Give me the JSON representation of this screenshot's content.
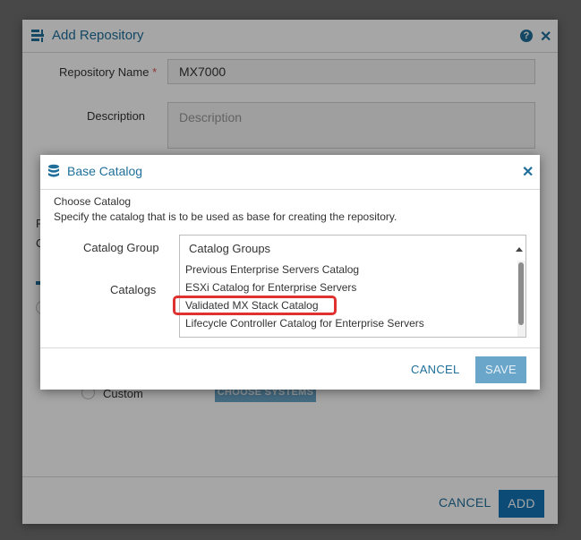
{
  "outer_dialog": {
    "title": "Add Repository",
    "help_icon": "?",
    "close_icon": "✕",
    "repository_name_label": "Repository Name",
    "required_marker": "*",
    "repository_name_value": "MX7000",
    "description_label": "Description",
    "description_placeholder": "Description",
    "partial_label_1": "R",
    "partial_label_2": "C",
    "custom_label": "Custom",
    "choose_systems_label": "CHOOSE SYSTEMS",
    "cancel_label": "CANCEL",
    "add_label": "ADD"
  },
  "base_catalog_dialog": {
    "title": "Base Catalog",
    "close_icon": "✕",
    "choose_heading": "Choose Catalog",
    "choose_description": "Specify the catalog that is to be used as base for creating the repository.",
    "catalog_group_label": "Catalog Group",
    "catalog_group_value": "Catalog Groups",
    "catalogs_label": "Catalogs",
    "catalogs": [
      "Previous Enterprise Servers Catalog",
      "ESXi Catalog for Enterprise Servers",
      "Validated MX Stack Catalog",
      "Lifecycle Controller Catalog for Enterprise Servers"
    ],
    "highlighted_catalog_index": 2,
    "cancel_label": "CANCEL",
    "save_label": "SAVE"
  },
  "colors": {
    "accent": "#1f6f9a",
    "primary_button": "#1273b4",
    "disabled_button": "#6aa6c9",
    "highlight": "#e03131",
    "required": "#d9534f"
  },
  "icons": {
    "outer_title_icon": "repository-icon",
    "inner_title_icon": "database-icon"
  }
}
